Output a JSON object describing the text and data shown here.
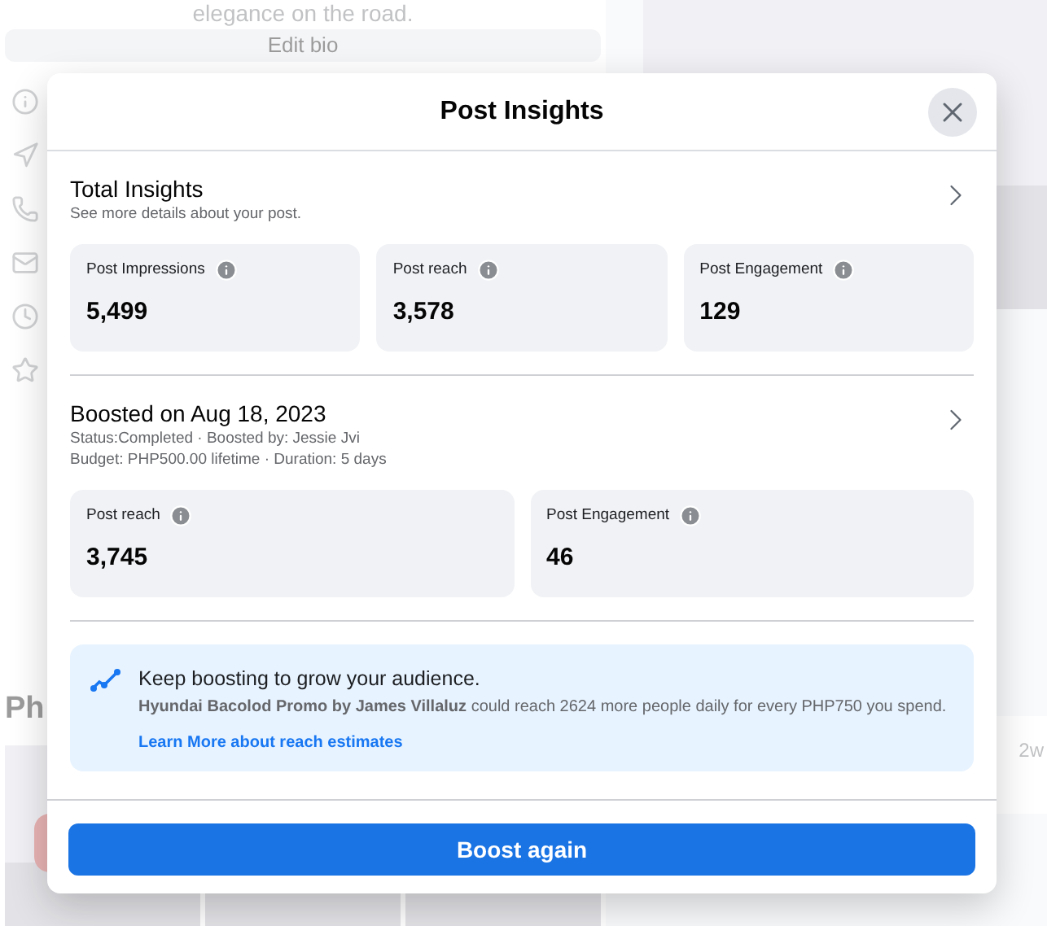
{
  "background": {
    "bio_text": "elegance on the road.",
    "edit_button": "Edit bio",
    "photos_heading": "Ph",
    "right_label": "2w"
  },
  "dialog": {
    "title": "Post Insights",
    "sections": [
      {
        "title": "Total Insights",
        "subtitle_lines": [
          "See more details about your post."
        ],
        "metrics": [
          {
            "label": "Post Impressions",
            "value": "5,499"
          },
          {
            "label": "Post reach",
            "value": "3,578"
          },
          {
            "label": "Post Engagement",
            "value": "129"
          }
        ]
      },
      {
        "title": "Boosted on Aug 18, 2023",
        "subtitle_lines": [
          "Status:Completed · Boosted by: Jessie Jvi",
          "Budget: PHP500.00 lifetime · Duration: 5 days"
        ],
        "metrics": [
          {
            "label": "Post reach",
            "value": "3,745"
          },
          {
            "label": "Post Engagement",
            "value": "46"
          }
        ]
      }
    ],
    "tip": {
      "heading": "Keep boosting to grow your audience.",
      "body": "**Hyundai Bacolod Promo by James Villaluz** could reach 2624 more people daily for every PHP750 you spend.",
      "link": "Learn More about reach estimates"
    },
    "button": "Boost again"
  }
}
